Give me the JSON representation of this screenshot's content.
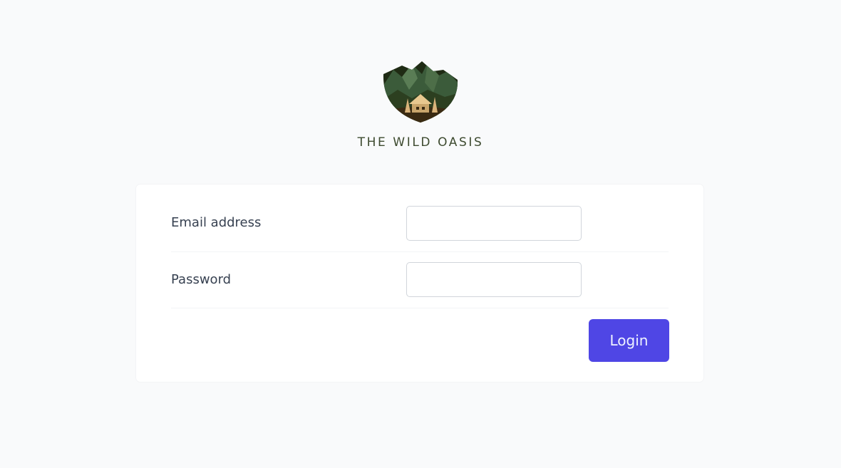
{
  "brand": {
    "name": "THE WILD OASIS",
    "logo_icon": "mountain-cabin-logo"
  },
  "form": {
    "email_label": "Email address",
    "email_value": "",
    "password_label": "Password",
    "password_value": "",
    "login_label": "Login"
  },
  "colors": {
    "background": "#f9fafb",
    "card": "#ffffff",
    "accent": "#4f46e5",
    "brand_text": "#3d4a2f"
  }
}
